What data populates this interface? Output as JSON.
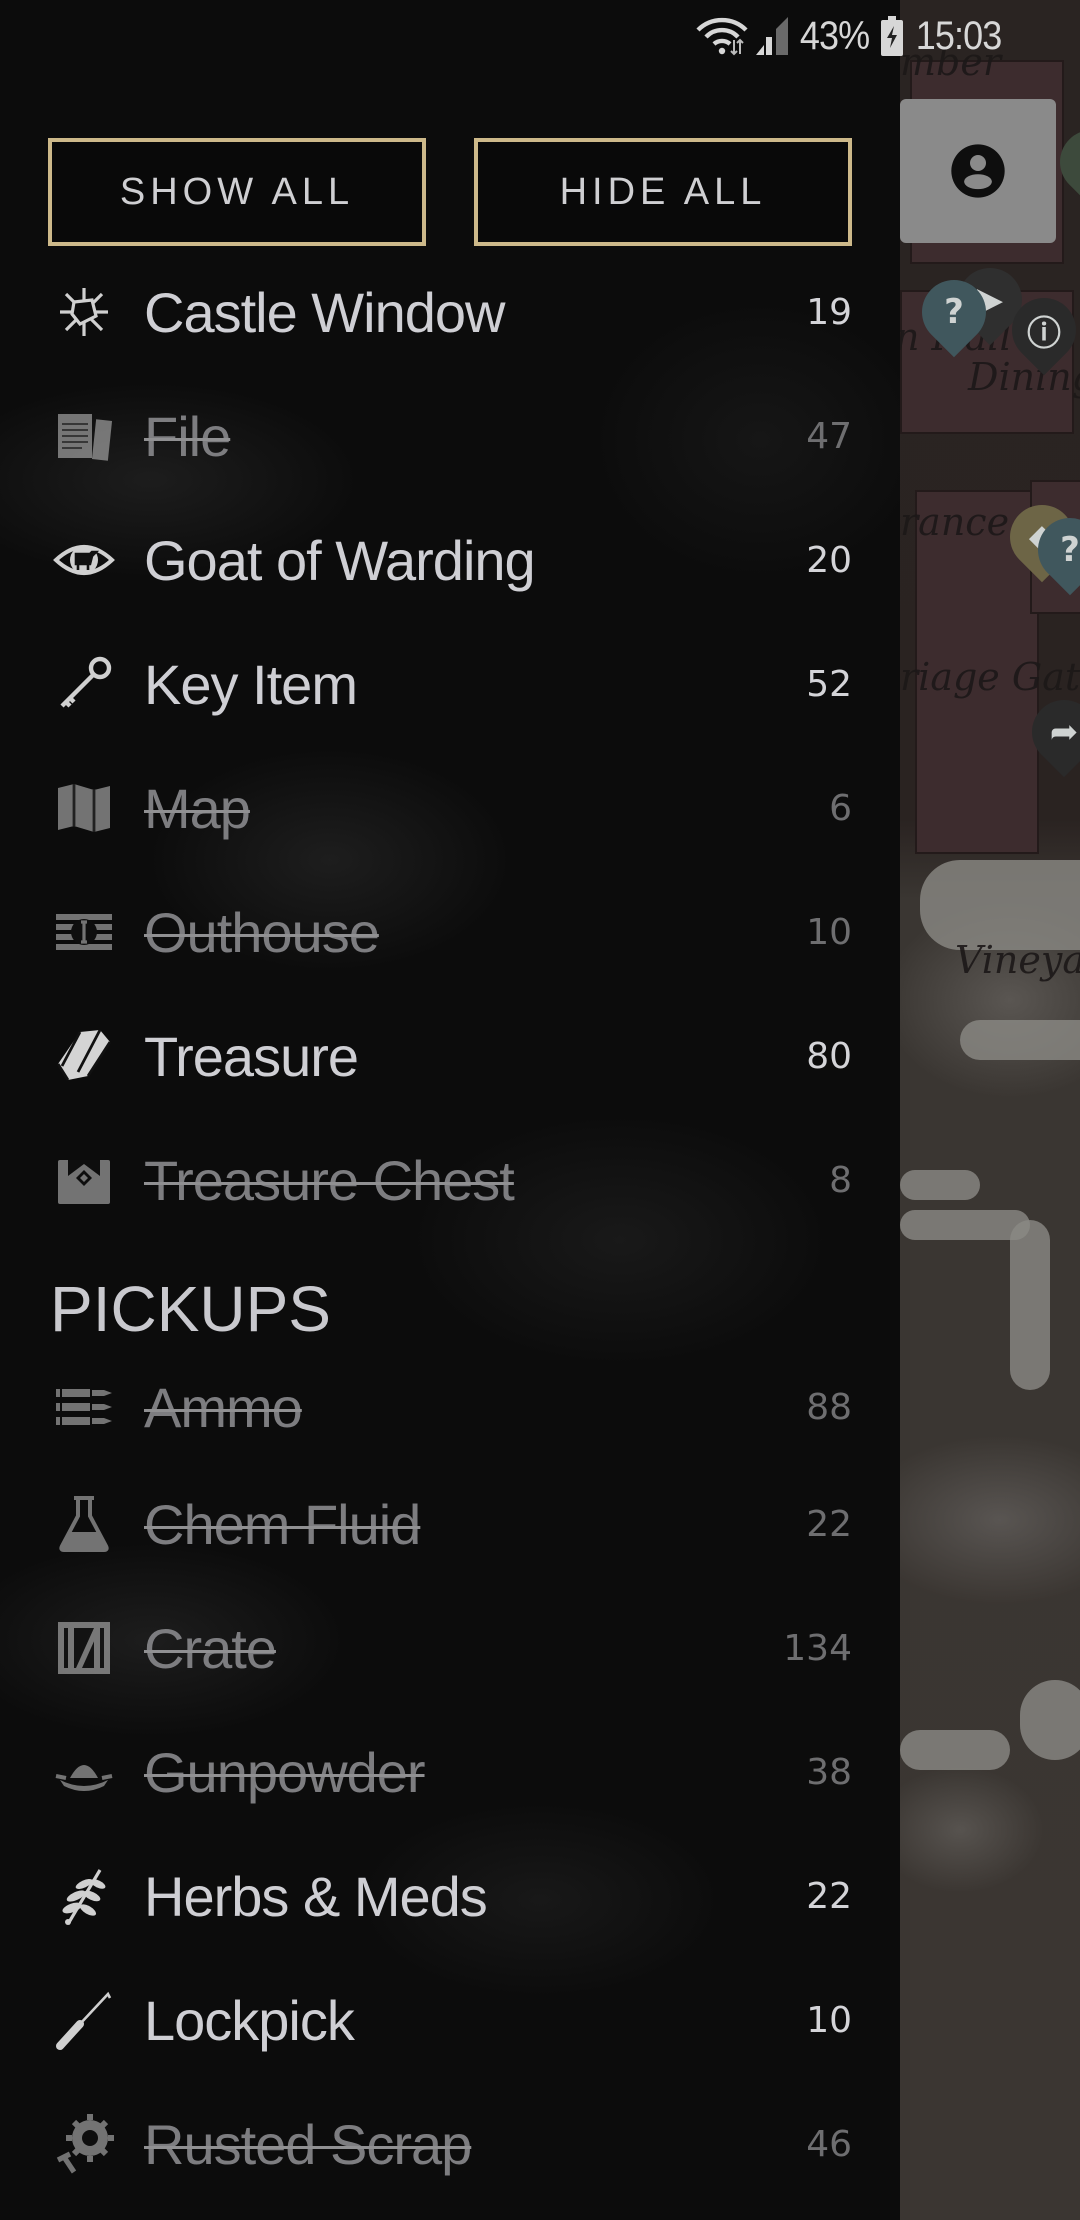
{
  "status_bar": {
    "battery_percent": "43%",
    "time": "15:03",
    "icons": [
      "wifi-icon",
      "signal-icon",
      "battery-charging-icon"
    ]
  },
  "map": {
    "labels": [
      "mber",
      "n Hall",
      "Dining",
      "rance",
      "riage Gat",
      "Vineya"
    ],
    "profile_button_icon": "account-circle-icon"
  },
  "drawer": {
    "show_all_label": "SHOW ALL",
    "hide_all_label": "HIDE ALL",
    "sections": [
      {
        "title": "",
        "items": [
          {
            "label": "Castle Window",
            "count": "19",
            "enabled": true,
            "icon": "broken-window-icon"
          },
          {
            "label": "File",
            "count": "47",
            "enabled": false,
            "icon": "file-documents-icon"
          },
          {
            "label": "Goat of Warding",
            "count": "20",
            "enabled": true,
            "icon": "goat-eye-icon"
          },
          {
            "label": "Key Item",
            "count": "52",
            "enabled": true,
            "icon": "key-icon"
          },
          {
            "label": "Map",
            "count": "6",
            "enabled": false,
            "icon": "map-icon"
          },
          {
            "label": "Outhouse",
            "count": "10",
            "enabled": false,
            "icon": "outhouse-icon"
          },
          {
            "label": "Treasure",
            "count": "80",
            "enabled": true,
            "icon": "gem-icon"
          },
          {
            "label": "Treasure Chest",
            "count": "8",
            "enabled": false,
            "icon": "treasure-chest-icon"
          }
        ]
      },
      {
        "title": "PICKUPS",
        "items": [
          {
            "label": "Ammo",
            "count": "88",
            "enabled": false,
            "icon": "ammo-icon"
          },
          {
            "label": "Chem Fluid",
            "count": "22",
            "enabled": false,
            "icon": "flask-icon"
          },
          {
            "label": "Crate",
            "count": "134",
            "enabled": false,
            "icon": "crate-icon"
          },
          {
            "label": "Gunpowder",
            "count": "38",
            "enabled": false,
            "icon": "gunpowder-icon"
          },
          {
            "label": "Herbs & Meds",
            "count": "22",
            "enabled": true,
            "icon": "herb-icon"
          },
          {
            "label": "Lockpick",
            "count": "10",
            "enabled": true,
            "icon": "lockpick-icon"
          },
          {
            "label": "Rusted Scrap",
            "count": "46",
            "enabled": false,
            "icon": "gear-scrap-icon"
          }
        ]
      }
    ]
  },
  "colors": {
    "accent_border": "#cdb98a",
    "text_enabled": "#cfcfd4",
    "text_disabled": "#7d7d80"
  }
}
